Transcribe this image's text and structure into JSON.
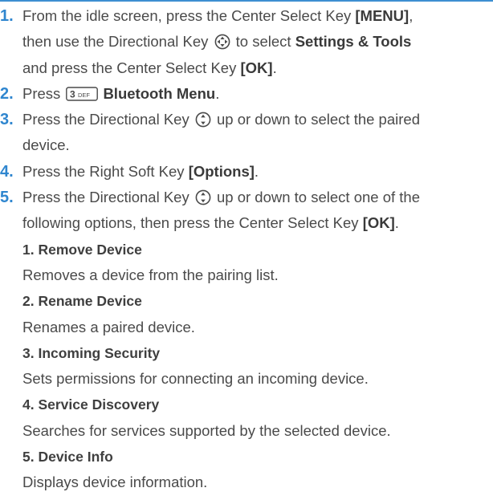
{
  "steps": [
    {
      "number": "1.",
      "line1": {
        "pre": "From the idle screen, press the Center Select Key ",
        "bold": "[MENU]",
        "post": ","
      },
      "line2": {
        "pre": "then use the Directional Key ",
        "mid": " to select ",
        "bold": "Settings & Tools"
      },
      "line3": {
        "pre": "and press the Center Select Key ",
        "bold": "[OK]",
        "post": "."
      }
    },
    {
      "number": "2.",
      "pre": "Press ",
      "key_label": "3 DEF",
      "bold": "Bluetooth Menu",
      "post": "."
    },
    {
      "number": "3.",
      "pre": "Press the Directional Key ",
      "post": " up or down to select the paired",
      "line2": "device."
    },
    {
      "number": "4.",
      "pre": "Press the Right Soft Key ",
      "bold": "[Options]",
      "post": "."
    },
    {
      "number": "5.",
      "pre": "Press the Directional Key ",
      "post": " up or down to select one of the",
      "line2_pre": "following options, then press the Center Select Key ",
      "line2_bold": "[OK]",
      "line2_post": "."
    }
  ],
  "options": [
    {
      "title": "1. Remove Device",
      "description": "Removes a device from the pairing list."
    },
    {
      "title": "2. Rename Device",
      "description": "Renames a paired device."
    },
    {
      "title": "3. Incoming Security",
      "description": "Sets permissions for connecting an incoming device."
    },
    {
      "title": "4. Service Discovery",
      "description": "Searches for services supported by the selected device."
    },
    {
      "title": "5. Device Info",
      "description": "Displays device information."
    }
  ],
  "icons": {
    "directional_4way": "directional-key-4way-icon",
    "directional_updown": "directional-key-updown-icon",
    "key_3": "key-3-def-icon"
  },
  "colors": {
    "accent": "#2f86cf",
    "rule": "#3d8fd1",
    "text": "#4a4a4a"
  }
}
